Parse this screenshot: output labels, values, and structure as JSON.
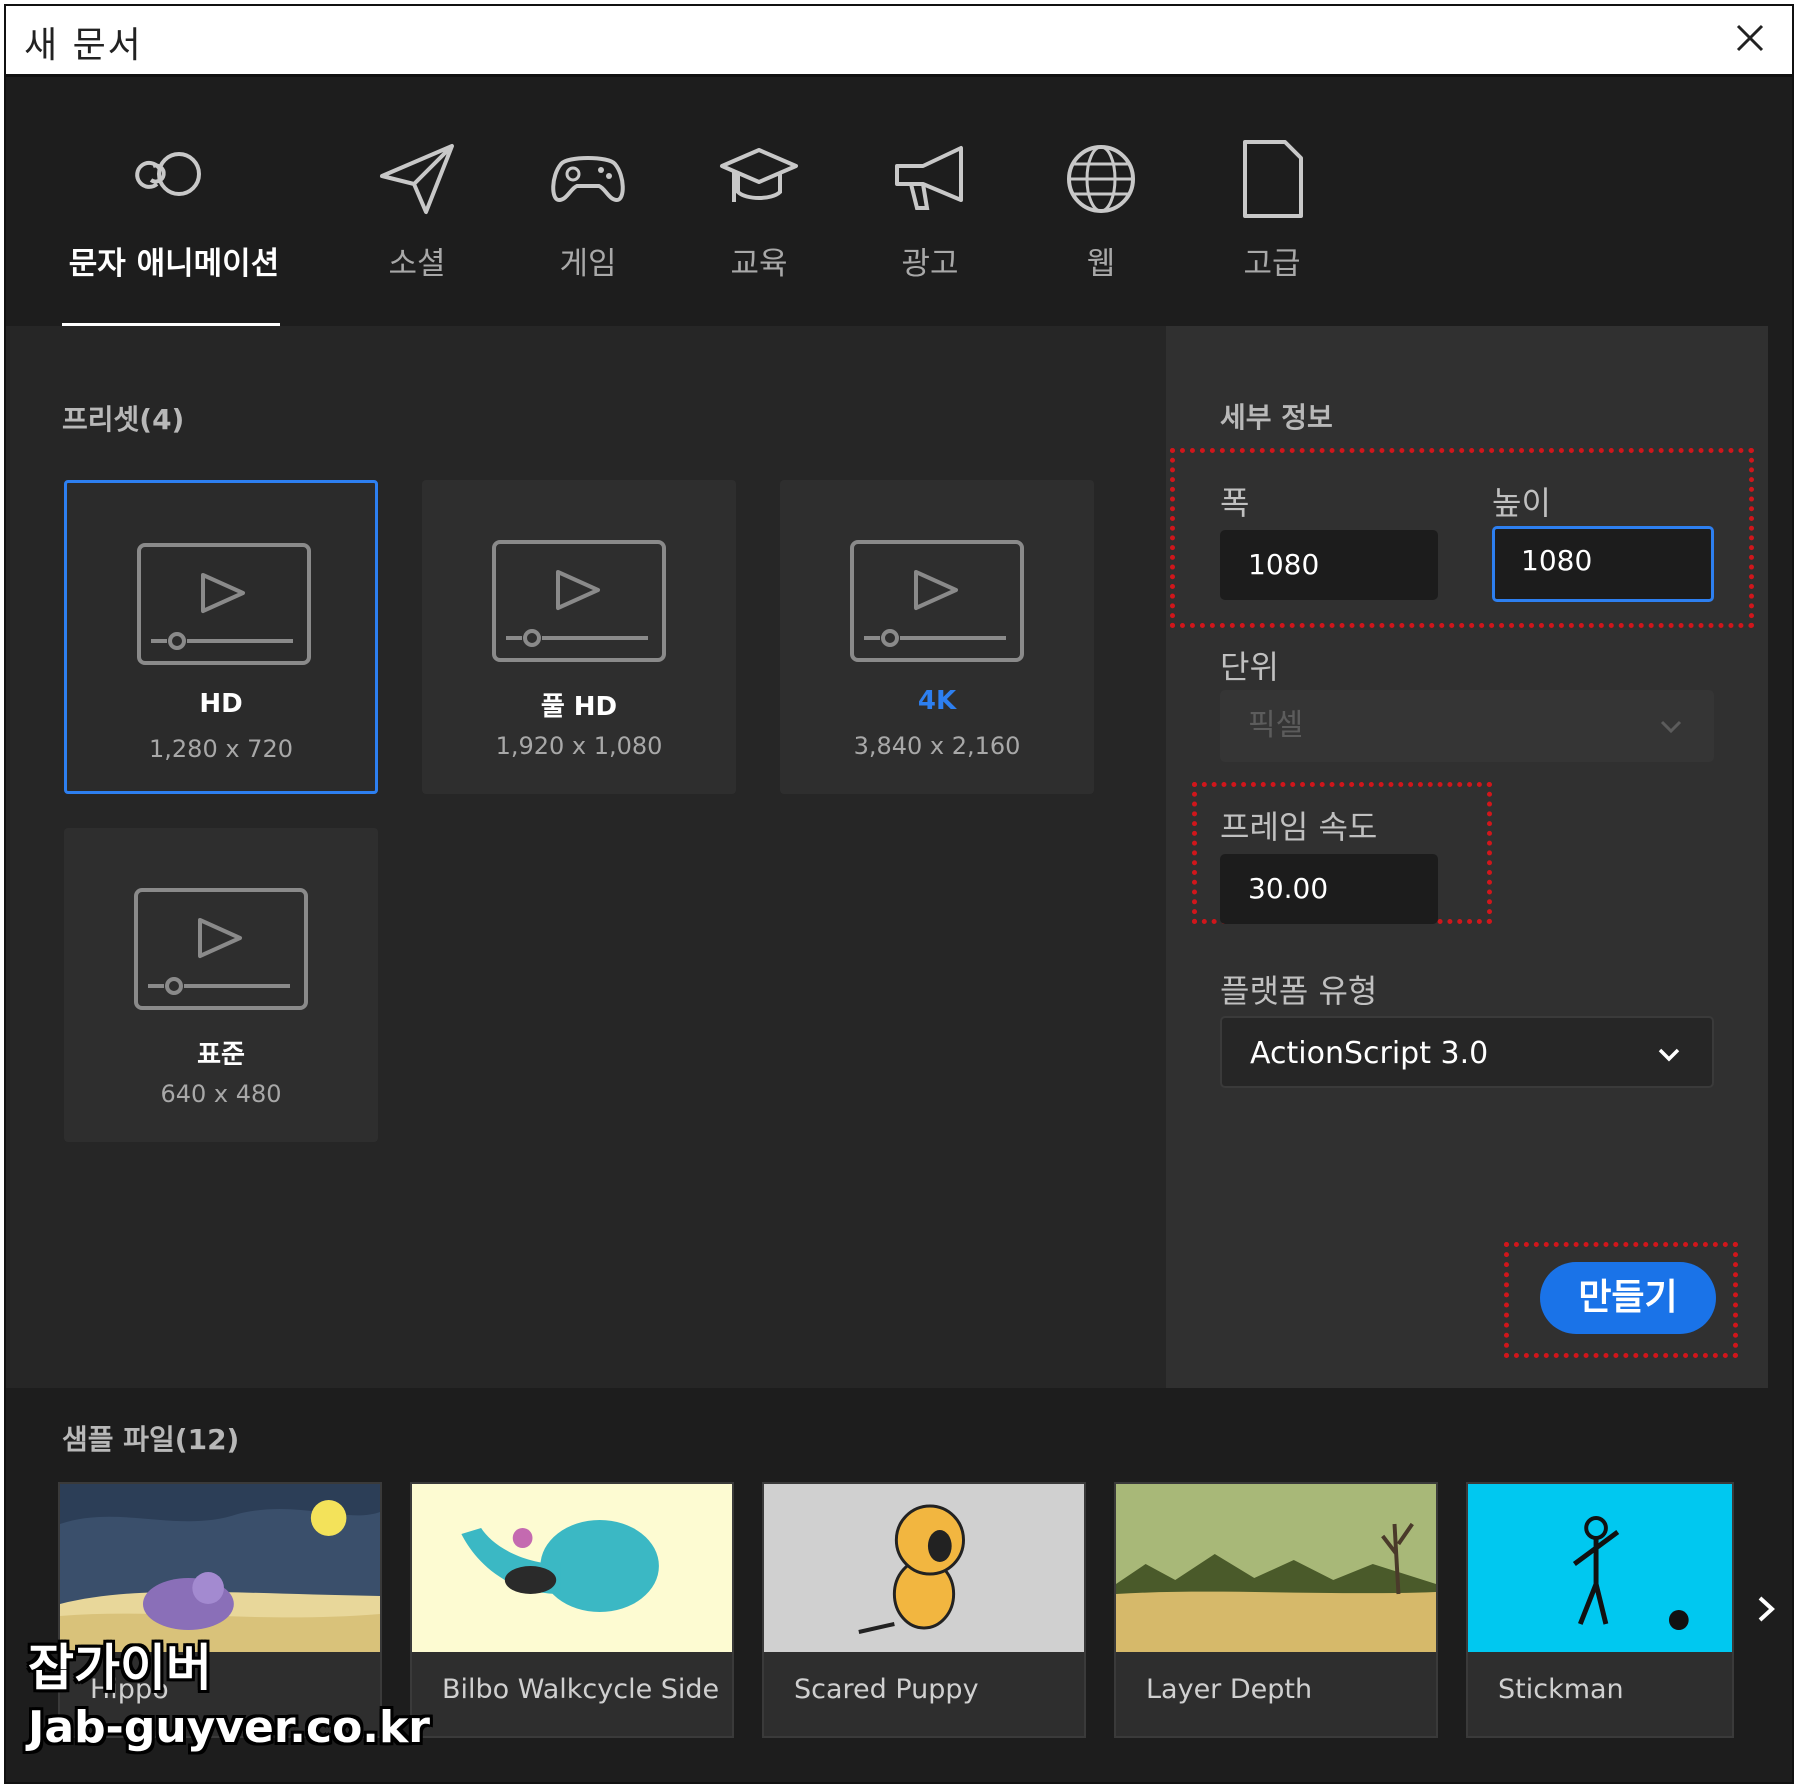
{
  "window": {
    "title": "새 문서"
  },
  "categories": [
    {
      "label": "문자 애니메이션",
      "icon": "character-animation-icon",
      "active": true
    },
    {
      "label": "소셜",
      "icon": "paper-plane-icon"
    },
    {
      "label": "게임",
      "icon": "gamepad-icon"
    },
    {
      "label": "교육",
      "icon": "graduation-cap-icon"
    },
    {
      "label": "광고",
      "icon": "megaphone-icon"
    },
    {
      "label": "웹",
      "icon": "globe-icon"
    },
    {
      "label": "고급",
      "icon": "document-icon"
    }
  ],
  "presets": {
    "title": "프리셋(4)",
    "items": [
      {
        "name": "HD",
        "dim": "1,280 x 720",
        "selected": true
      },
      {
        "name": "풀 HD",
        "dim": "1,920 x 1,080"
      },
      {
        "name": "4K",
        "dim": "3,840 x 2,160",
        "name_color": "#2d7ff0"
      },
      {
        "name": "표준",
        "dim": "640 x 480"
      }
    ]
  },
  "details": {
    "title": "세부 정보",
    "width_label": "폭",
    "width_value": "1080",
    "height_label": "높이",
    "height_value": "1080",
    "units_label": "단위",
    "units_value": "픽셀",
    "framerate_label": "프레임 속도",
    "framerate_value": "30.00",
    "platform_label": "플랫폼 유형",
    "platform_value": "ActionScript 3.0",
    "create_label": "만들기"
  },
  "samples": {
    "title": "샘플 파일(12)",
    "items": [
      {
        "name": "Hippo"
      },
      {
        "name": "Bilbo Walkcycle Side"
      },
      {
        "name": "Scared Puppy"
      },
      {
        "name": "Layer Depth"
      },
      {
        "name": "Stickman"
      }
    ]
  },
  "watermark": {
    "line1": "잡가이버",
    "line2": "Jab-guyver.co.kr"
  },
  "colors": {
    "accent": "#1a73e8",
    "focus_border": "#2d7ff0",
    "highlight_dotted": "#d0161b"
  }
}
